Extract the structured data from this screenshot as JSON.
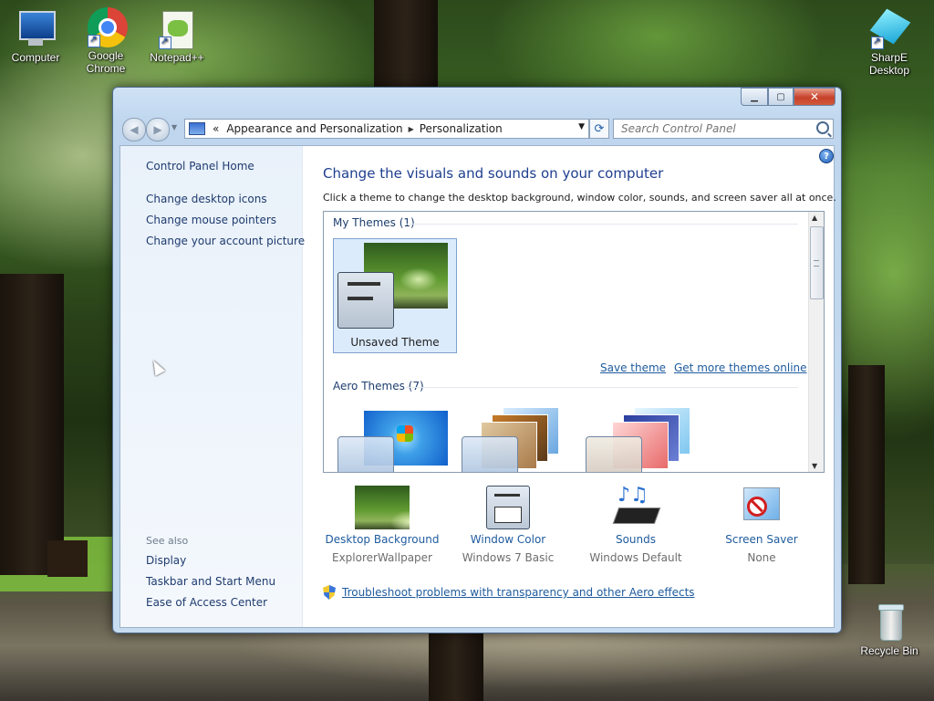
{
  "desktop": {
    "icons": [
      {
        "name": "computer-icon",
        "label": "Computer"
      },
      {
        "name": "chrome-icon",
        "label": "Google Chrome"
      },
      {
        "name": "notepad-plus-plus-icon",
        "label": "Notepad++"
      },
      {
        "name": "sharpe-desktop-icon",
        "label": "SharpE Desktop"
      },
      {
        "name": "recycle-bin-icon",
        "label": "Recycle Bin"
      }
    ]
  },
  "window": {
    "caption_buttons": {
      "minimize": "▁",
      "maximize": "▢",
      "close": "✕"
    },
    "breadcrumb": {
      "prefix": "«",
      "items": [
        "Appearance and Personalization",
        "Personalization"
      ]
    },
    "search": {
      "placeholder": "Search Control Panel"
    },
    "left_pane": {
      "home": "Control Panel Home",
      "links": [
        "Change desktop icons",
        "Change mouse pointers",
        "Change your account picture"
      ],
      "see_also_title": "See also",
      "see_also": [
        "Display",
        "Taskbar and Start Menu",
        "Ease of Access Center"
      ]
    },
    "main": {
      "heading": "Change the visuals and sounds on your computer",
      "subheading": "Click a theme to change the desktop background, window color, sounds, and screen saver all at once.",
      "my_themes_title": "My Themes (1)",
      "unsaved_theme": "Unsaved Theme",
      "save_theme": "Save theme",
      "get_more": "Get more themes online",
      "aero_title": "Aero Themes (7)",
      "bottom_items": [
        {
          "name": "desktop-background",
          "label": "Desktop Background",
          "value": "ExplorerWallpaper"
        },
        {
          "name": "window-color",
          "label": "Window Color",
          "value": "Windows 7 Basic"
        },
        {
          "name": "sounds",
          "label": "Sounds",
          "value": "Windows Default"
        },
        {
          "name": "screen-saver",
          "label": "Screen Saver",
          "value": "None"
        }
      ],
      "troubleshoot": "Troubleshoot problems with transparency and other Aero effects"
    }
  },
  "colors": {
    "link": "#1e5b9e",
    "heading": "#1e3f8f",
    "selection": "#dcebfc"
  }
}
